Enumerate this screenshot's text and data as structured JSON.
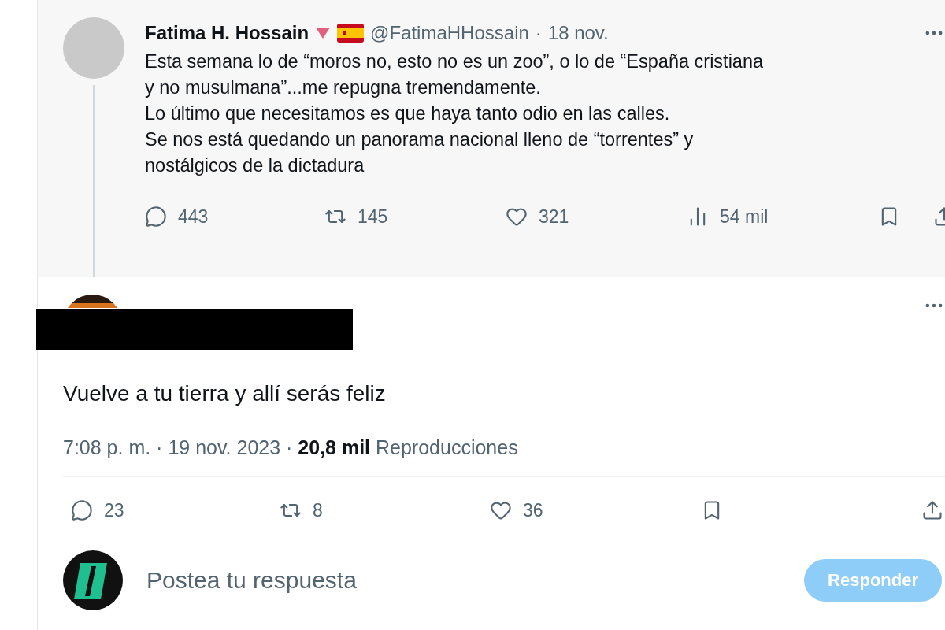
{
  "thread_tweet": {
    "author": "Fatima H. Hossain",
    "handle": "@FatimaHHossain",
    "separator": "·",
    "date": "18 nov.",
    "text": "Esta semana lo de “moros no, esto no es un zoo”, o lo de “España cristiana\ny no musulmana”...me repugna tremendamente.\nLo último que necesitamos es que haya tanto odio en las calles.\nSe nos está quedando un panorama  nacional lleno de “torrentes” y\nnostálgicos de la dictadura",
    "actions": [
      {
        "kind": "reply",
        "count": "443"
      },
      {
        "kind": "repost",
        "count": "145"
      },
      {
        "kind": "like",
        "count": "321"
      },
      {
        "kind": "views",
        "count": "54 mil"
      },
      {
        "kind": "bookmark"
      },
      {
        "kind": "share"
      }
    ]
  },
  "reply_tweet": {
    "text": "Vuelve a tu tierra y allí serás feliz",
    "meta": "7:08 p. m. · 19 nov. 2023 · **20,8 mil** Reproducciones",
    "actions": [
      {
        "kind": "reply",
        "count": "23"
      },
      {
        "kind": "repost",
        "count": "8"
      },
      {
        "kind": "like",
        "count": "36"
      },
      {
        "kind": "bookmark"
      },
      {
        "kind": "share"
      }
    ]
  },
  "composer": {
    "placeholder": "Postea tu respuesta",
    "button": {
      "label": "Responder",
      "disabled": true
    }
  }
}
